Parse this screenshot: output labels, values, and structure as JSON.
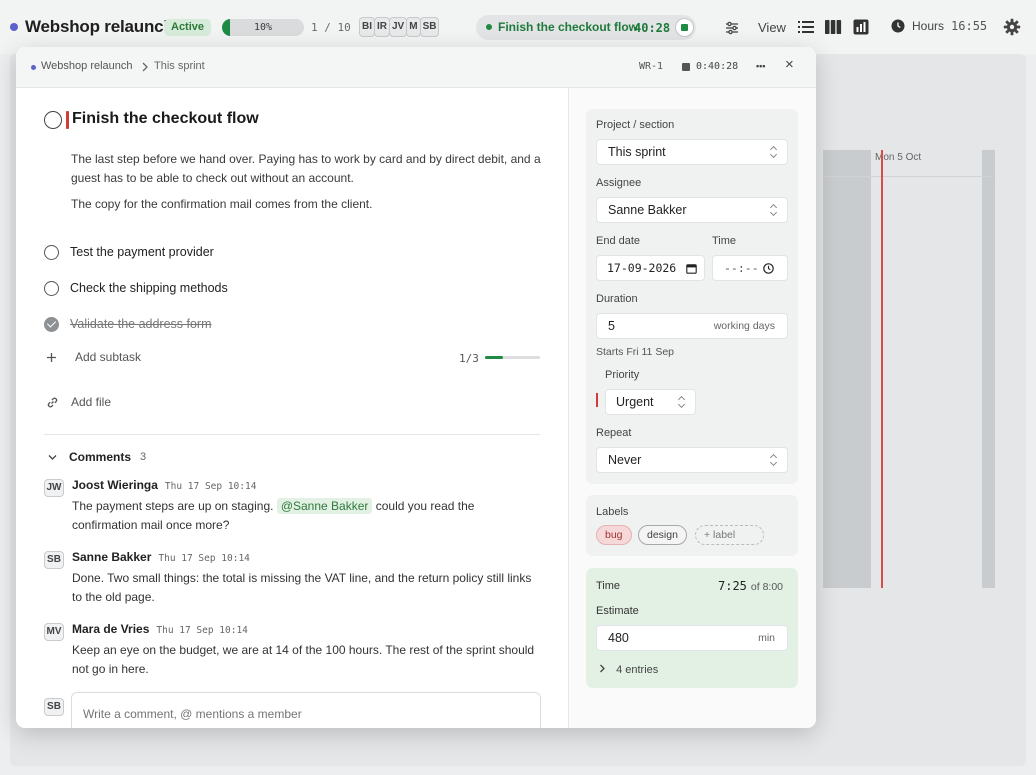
{
  "topbar": {
    "project_title": "Webshop relaunch",
    "status_badge": "Active",
    "progress": {
      "value": 0.1,
      "label": "10%"
    },
    "task_count": "1 / 10",
    "members": [
      "BI",
      "IR",
      "JV",
      "M",
      "SB"
    ],
    "timer": {
      "task": "Finish the checkout flow",
      "elapsed": "40:28"
    },
    "view_label": "View",
    "hours_label": "Hours",
    "hours_value": "16:55"
  },
  "board": {
    "date_label": "Mon 5 Oct"
  },
  "modal": {
    "breadcrumb": {
      "project": "Webshop relaunch",
      "section": "This sprint"
    },
    "task_id": "WR-1",
    "timer": "0:40:28",
    "more_label": "•••",
    "close_label": "×",
    "task": {
      "title": "Finish the checkout flow",
      "description": [
        "The last step before we hand over. Paying has to work by card and by direct debit, and a guest has to be able to check out without an account.",
        "The copy for the confirmation mail comes from the client."
      ]
    },
    "subtasks": [
      {
        "label": "Test the payment provider",
        "done": false
      },
      {
        "label": "Check the shipping methods",
        "done": false
      },
      {
        "label": "Validate the address form",
        "done": true
      }
    ],
    "add_subtask_label": "Add subtask",
    "subtask_progress": {
      "label": "1/3",
      "value": 0.333
    },
    "add_file_label": "Add file",
    "comments": {
      "label": "Comments",
      "count": "3",
      "items": [
        {
          "initials": "JW",
          "author": "Joost Wieringa",
          "time": "Thu 17 Sep 10:14",
          "text_before": "The payment steps are up on staging.",
          "mention": "@Sanne Bakker",
          "text_after": "could you read the confirmation mail once more?"
        },
        {
          "initials": "SB",
          "author": "Sanne Bakker",
          "time": "Thu 17 Sep 10:14",
          "text": "Done. Two small things: the total is missing the VAT line, and the return policy still links to the old page."
        },
        {
          "initials": "MV",
          "author": "Mara de Vries",
          "time": "Thu 17 Sep 10:14",
          "text": "Keep an eye on the budget, we are at 14 of the 100 hours. The rest of the sprint should not go in here."
        }
      ],
      "new_comment_initials": "SB",
      "new_comment_placeholder": "Write a comment, @ mentions a member"
    },
    "fields": {
      "project_section": {
        "label": "Project / section",
        "value": "This sprint"
      },
      "assignee": {
        "label": "Assignee",
        "value": "Sanne Bakker"
      },
      "end_date": {
        "label": "End date",
        "value": "17-09-2026"
      },
      "time": {
        "label": "Time",
        "value": "--:--"
      },
      "duration": {
        "label": "Duration",
        "value": "5",
        "unit": "working days",
        "hint": "Starts Fri 11 Sep"
      },
      "priority": {
        "label": "Priority",
        "value": "Urgent"
      },
      "repeat": {
        "label": "Repeat",
        "value": "Never"
      }
    },
    "labels": {
      "label": "Labels",
      "chips": [
        "bug",
        "design"
      ],
      "add_label": "+ label"
    },
    "time_tracking": {
      "label": "Time",
      "tracked": "7:25",
      "of": "of 8:00",
      "estimate_label": "Estimate",
      "estimate_value": "480",
      "estimate_unit": "min",
      "entries_label": "4 entries"
    }
  },
  "colors": {
    "accent_green": "#1f8a43",
    "urgent_red": "#d33b3b",
    "project_dot": "#5a63c9"
  }
}
